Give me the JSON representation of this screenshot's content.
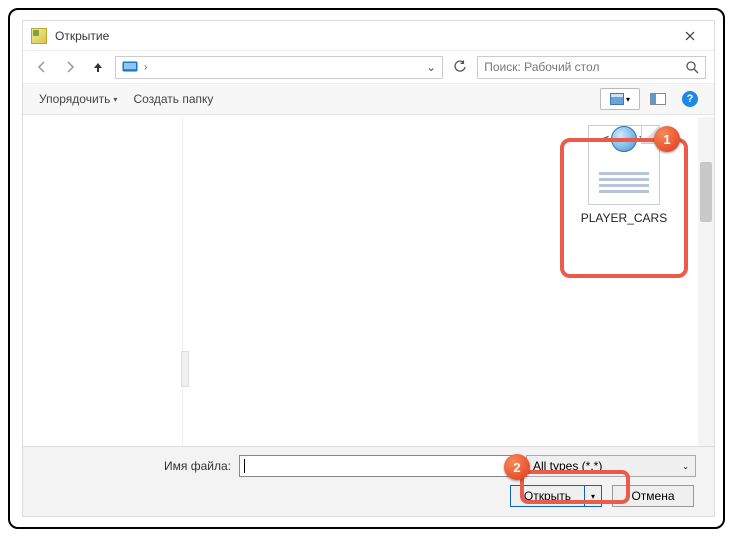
{
  "dialog": {
    "title": "Открытие",
    "search_placeholder": "Поиск: Рабочий стол"
  },
  "toolbar": {
    "organize": "Упорядочить",
    "new_folder": "Создать папку"
  },
  "file": {
    "name": "PLAYER_CARS"
  },
  "bottom": {
    "filename_label": "Имя файла:",
    "filename_value": "",
    "filter": "All types (*.*)",
    "open": "Открыть",
    "cancel": "Отмена"
  },
  "badges": {
    "one": "1",
    "two": "2"
  },
  "help": "?"
}
